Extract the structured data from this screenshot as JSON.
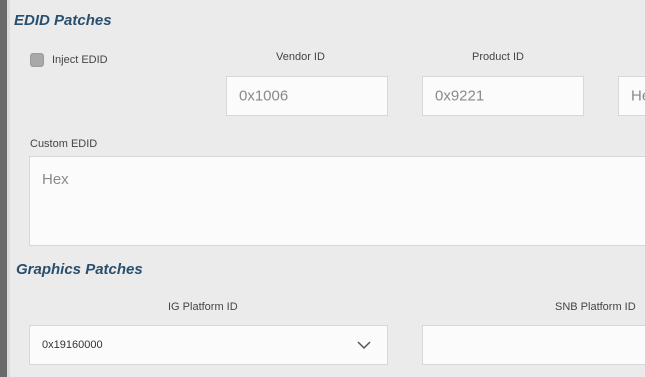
{
  "edid": {
    "heading": "EDID Patches",
    "inject_label": "Inject EDID",
    "vendor_label": "Vendor ID",
    "vendor_value": "0x1006",
    "product_label": "Product ID",
    "product_value": "0x9221",
    "partial_value": "He",
    "custom_label": "Custom EDID",
    "custom_placeholder": "Hex"
  },
  "graphics": {
    "heading": "Graphics Patches",
    "ig_label": "IG Platform ID",
    "ig_value": "0x19160000",
    "snb_label": "SNB Platform ID"
  }
}
